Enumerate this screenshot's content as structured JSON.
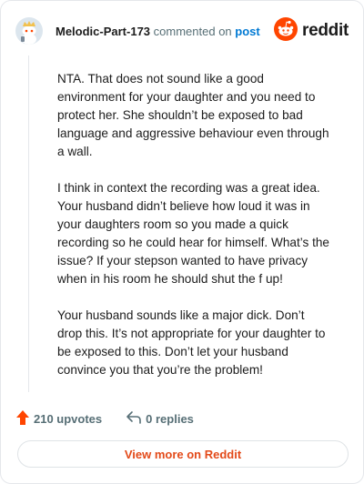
{
  "header": {
    "author": "Melodic-Part-173",
    "action_text": "commented on",
    "post_link": "post",
    "brand_name": "reddit"
  },
  "comment": {
    "paragraphs": [
      "NTA. That does not sound like a good environment for your daughter and you need to protect her. She shouldn’t be exposed to bad language and aggressive behaviour even through a wall.",
      "I think in context the recording was a great idea. Your husband didn’t believe how loud it was in your daughters room so you made a quick recording so he could hear for himself. What’s the issue? If your stepson wanted to have privacy when in his room he should shut the f up!",
      "Your husband sounds like a major dick. Don’t drop this. It’s not appropriate for your daughter to be exposed to this. Don’t let your husband convince you that you’re the problem!"
    ]
  },
  "actions": {
    "upvotes": "210 upvotes",
    "replies": "0 replies"
  },
  "footer": {
    "view_more_label": "View more on Reddit"
  },
  "colors": {
    "accent": "#ff4500",
    "link": "#0079d3",
    "muted": "#576f76",
    "view_more": "#e34a19"
  },
  "icons": {
    "avatar": "snoo-avatar-icon",
    "brand": "reddit-logo-icon",
    "upvote": "upvote-arrow-icon",
    "reply": "reply-arrow-icon"
  }
}
